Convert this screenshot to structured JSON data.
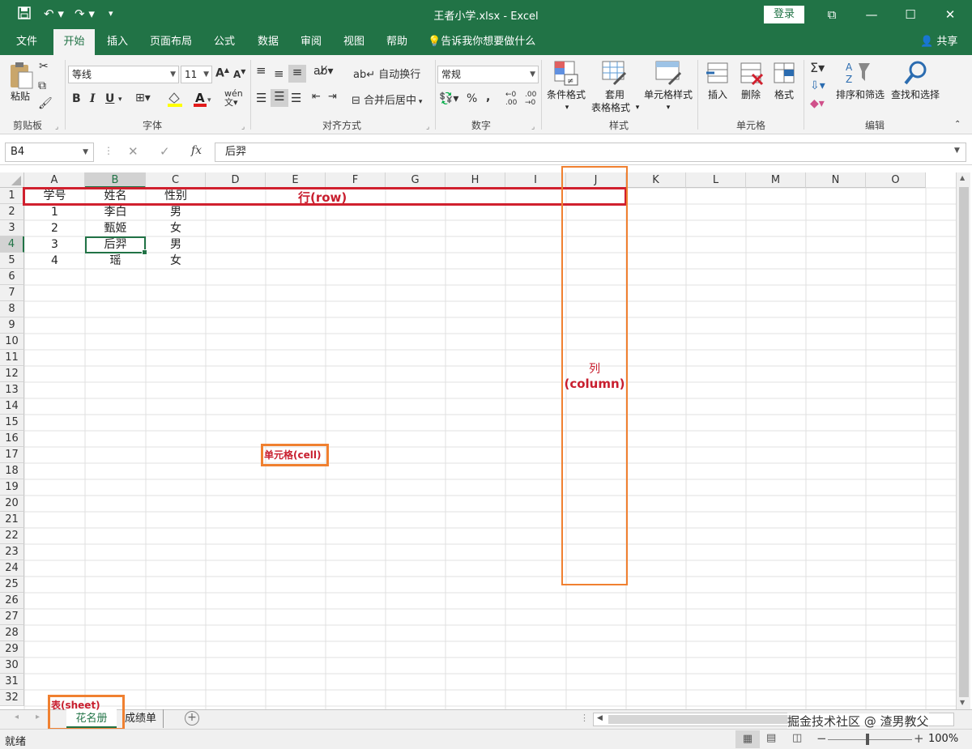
{
  "titlebar": {
    "title": "王者小学.xlsx  -  Excel",
    "login": "登录",
    "save_icon": "save-icon",
    "undo_icon": "undo-icon",
    "redo_icon": "redo-icon"
  },
  "menu": {
    "tabs": [
      "文件",
      "开始",
      "插入",
      "页面布局",
      "公式",
      "数据",
      "审阅",
      "视图",
      "帮助"
    ],
    "tell_me": "告诉我你想要做什么",
    "share": "共享"
  },
  "ribbon": {
    "clipboard": {
      "paste": "粘贴",
      "label": "剪贴板"
    },
    "font": {
      "name": "等线",
      "size": "11",
      "label": "字体"
    },
    "alignment": {
      "wrap": "自动换行",
      "merge": "合并后居中",
      "label": "对齐方式"
    },
    "number": {
      "format": "常规",
      "label": "数字"
    },
    "styles": {
      "conditional": "条件格式",
      "table1": "套用",
      "table2": "表格格式",
      "cell_styles": "单元格样式",
      "label": "样式"
    },
    "cells": {
      "insert": "插入",
      "delete": "删除",
      "format": "格式",
      "label": "单元格"
    },
    "editing": {
      "sort": "排序和筛选",
      "find": "查找和选择",
      "label": "编辑"
    }
  },
  "formula_bar": {
    "name_box": "B4",
    "fx": "fx",
    "value": "后羿"
  },
  "grid": {
    "columns": [
      "A",
      "B",
      "C",
      "D",
      "E",
      "F",
      "G",
      "H",
      "I",
      "J",
      "K",
      "L",
      "M",
      "N",
      "O"
    ],
    "rows": [
      "1",
      "2",
      "3",
      "4",
      "5",
      "6",
      "7",
      "8",
      "9",
      "10",
      "11",
      "12",
      "13",
      "14",
      "15",
      "16",
      "17",
      "18",
      "19",
      "20",
      "21",
      "22",
      "23",
      "24",
      "25",
      "26",
      "27",
      "28",
      "29",
      "30",
      "31",
      "32"
    ],
    "data": [
      [
        "学号",
        "姓名",
        "性别"
      ],
      [
        "1",
        "李白",
        "男"
      ],
      [
        "2",
        "甄姬",
        "女"
      ],
      [
        "3",
        "后羿",
        "男"
      ],
      [
        "4",
        "瑶",
        "女"
      ]
    ]
  },
  "annotations": {
    "row": "行(row)",
    "column_1": "列",
    "column_2": "(column)",
    "cell": "单元格(cell)",
    "sheet": "表(sheet)"
  },
  "sheets": [
    "花名册",
    "成绩单"
  ],
  "status": {
    "ready": "就绪",
    "zoom": "100%",
    "watermark": "掘金技术社区 @ 渣男教父"
  }
}
